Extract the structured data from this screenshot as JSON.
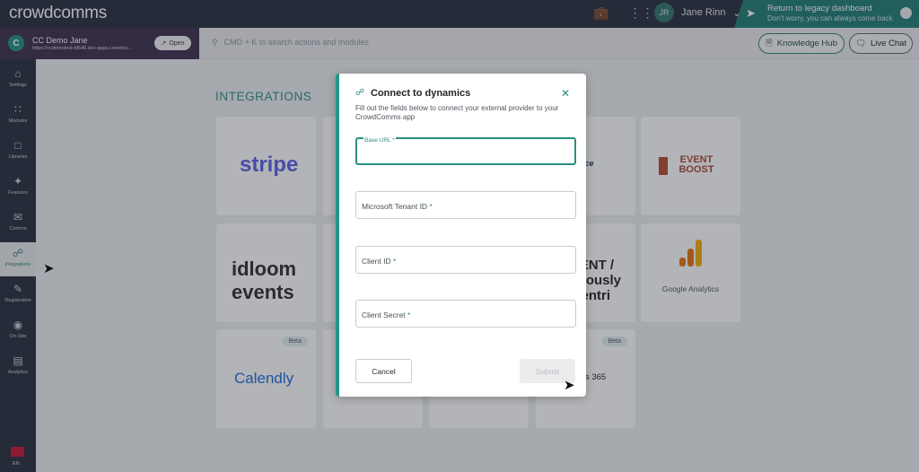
{
  "top": {
    "logo": "crowdcomms",
    "user_initials": "JR",
    "user_name": "Jane Rinn",
    "legacy_title": "Return to legacy dashboard",
    "legacy_sub": "Don't worry, you can always come back"
  },
  "event": {
    "name": "CC Demo Jane",
    "url": "https://ccdemotest-bf646.dev-apps.crowdco...",
    "open_label": "Open"
  },
  "search": {
    "placeholder": "CMD + K to search actions and modules"
  },
  "help": {
    "knowledge_hub": "Knowledge Hub",
    "live_chat": "Live Chat"
  },
  "sidebar": {
    "items": [
      {
        "label": "Settings",
        "icon": "home-icon"
      },
      {
        "label": "Modules",
        "icon": "grid-icon"
      },
      {
        "label": "Libraries",
        "icon": "folder-icon"
      },
      {
        "label": "Features",
        "icon": "sparkle-icon"
      },
      {
        "label": "Comms",
        "icon": "comms-icon"
      },
      {
        "label": "Integrations",
        "icon": "puzzle-icon"
      },
      {
        "label": "Registration",
        "icon": "registration-icon"
      },
      {
        "label": "On-Site",
        "icon": "onsite-icon"
      },
      {
        "label": "Analytics",
        "icon": "analytics-icon"
      }
    ],
    "language": "EN"
  },
  "page": {
    "heading": "INTEGRATIONS"
  },
  "cards": [
    {
      "name": "stripe",
      "beta": ""
    },
    {
      "name": "",
      "beta": ""
    },
    {
      "name": "",
      "beta": ""
    },
    {
      "name": "salesforce",
      "beta": ""
    },
    {
      "name": "EVENT BOOST",
      "beta": ""
    },
    {
      "name": "idloom events",
      "beta": ""
    },
    {
      "name": "",
      "beta": ""
    },
    {
      "name": "",
      "beta": ""
    },
    {
      "name": "CVENT / previously Aventri",
      "beta": ""
    },
    {
      "name": "Google Analytics",
      "beta": ""
    },
    {
      "name": "Calendly",
      "beta": "Beta"
    },
    {
      "name": "",
      "beta": ""
    },
    {
      "name": "",
      "beta": ""
    },
    {
      "name": "Dynamics 365",
      "beta": "Beta"
    }
  ],
  "modal": {
    "title": "Connect to dynamics",
    "description": "Fill out the fields below to connect your external provider to your CrowdComms app",
    "fields": {
      "base_url": {
        "label": "Base URL",
        "value": ""
      },
      "tenant": {
        "label": "Microsoft Tenant ID",
        "value": ""
      },
      "client_id": {
        "label": "Client ID",
        "value": ""
      },
      "client_secret": {
        "label": "Client Secret",
        "value": ""
      }
    },
    "required_mark": "*",
    "cancel_label": "Cancel",
    "submit_label": "Submit"
  },
  "brand_colors": {
    "teal": "#2c8d82",
    "dark": "#242a3a",
    "event_bg": "#3b2b4a"
  }
}
